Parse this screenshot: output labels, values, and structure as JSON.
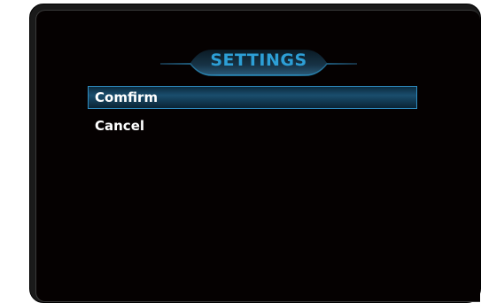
{
  "dialog": {
    "title": "SETTINGS"
  },
  "menu": {
    "items": [
      {
        "label": "Comfirm",
        "selected": true
      },
      {
        "label": "Cancel",
        "selected": false
      }
    ]
  },
  "colors": {
    "accent": "#2d9fd6",
    "selected_border": "#2f8cc0",
    "background": "#050101",
    "text": "#ffffff"
  }
}
